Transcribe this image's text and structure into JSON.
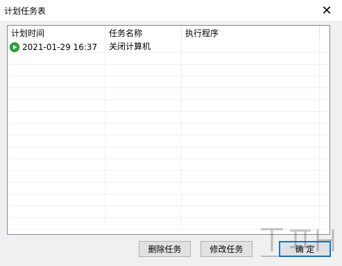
{
  "window": {
    "title": "计划任务表",
    "close_glyph": "✕"
  },
  "table": {
    "columns": [
      "计划时间",
      "任务名称",
      "执行程序"
    ],
    "rows": [
      {
        "icon": "play-icon",
        "time": "2021-01-29 16:37",
        "task": "关闭计算机",
        "program": ""
      }
    ],
    "empty_rows": 15
  },
  "buttons": {
    "delete": "删除任务",
    "modify": "修改任务",
    "ok": "确 定"
  },
  "colors": {
    "accent": "#0078d7",
    "play_green": "#2fa83a"
  }
}
